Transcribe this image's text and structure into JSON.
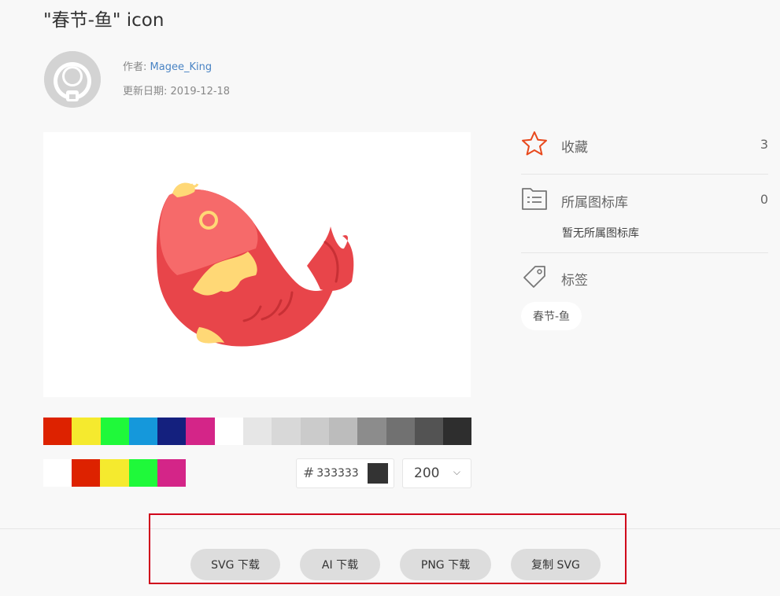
{
  "page": {
    "title": "\"春节-鱼\" icon"
  },
  "meta": {
    "author_label": "作者:",
    "author_name": "Magee_King",
    "date_label": "更新日期:",
    "date_value": "2019-12-18"
  },
  "palette": {
    "colors": [
      "#dd2200",
      "#f5ea2e",
      "#1ff93a",
      "#1598db",
      "#14207e",
      "#d42588",
      "#ffffff",
      "#e6e6e6",
      "#d8d8d8",
      "#cbcbcb",
      "#bcbcbc",
      "#8c8c8c",
      "#717171",
      "#535353",
      "#2e2e2e"
    ],
    "recent_colors": [
      "#ffffff",
      "#dd2200",
      "#f5ea2e",
      "#1ff93a",
      "#d42588"
    ]
  },
  "color_input": {
    "hash": "#",
    "value": "333333",
    "swatch_color": "#333333"
  },
  "size_select": {
    "value": "200"
  },
  "sidebar": {
    "favorite": {
      "label": "收藏",
      "count": "3",
      "icon": "star-icon",
      "color": "#e8491d"
    },
    "library": {
      "label": "所属图标库",
      "count": "0",
      "empty_text": "暂无所属图标库",
      "icon": "folder-list-icon"
    },
    "tags": {
      "label": "标签",
      "icon": "tag-icon",
      "items": [
        "春节-鱼"
      ]
    }
  },
  "downloads": {
    "svg": "SVG 下载",
    "ai": "AI 下载",
    "png": "PNG 下载",
    "copy_svg": "复制 SVG"
  }
}
